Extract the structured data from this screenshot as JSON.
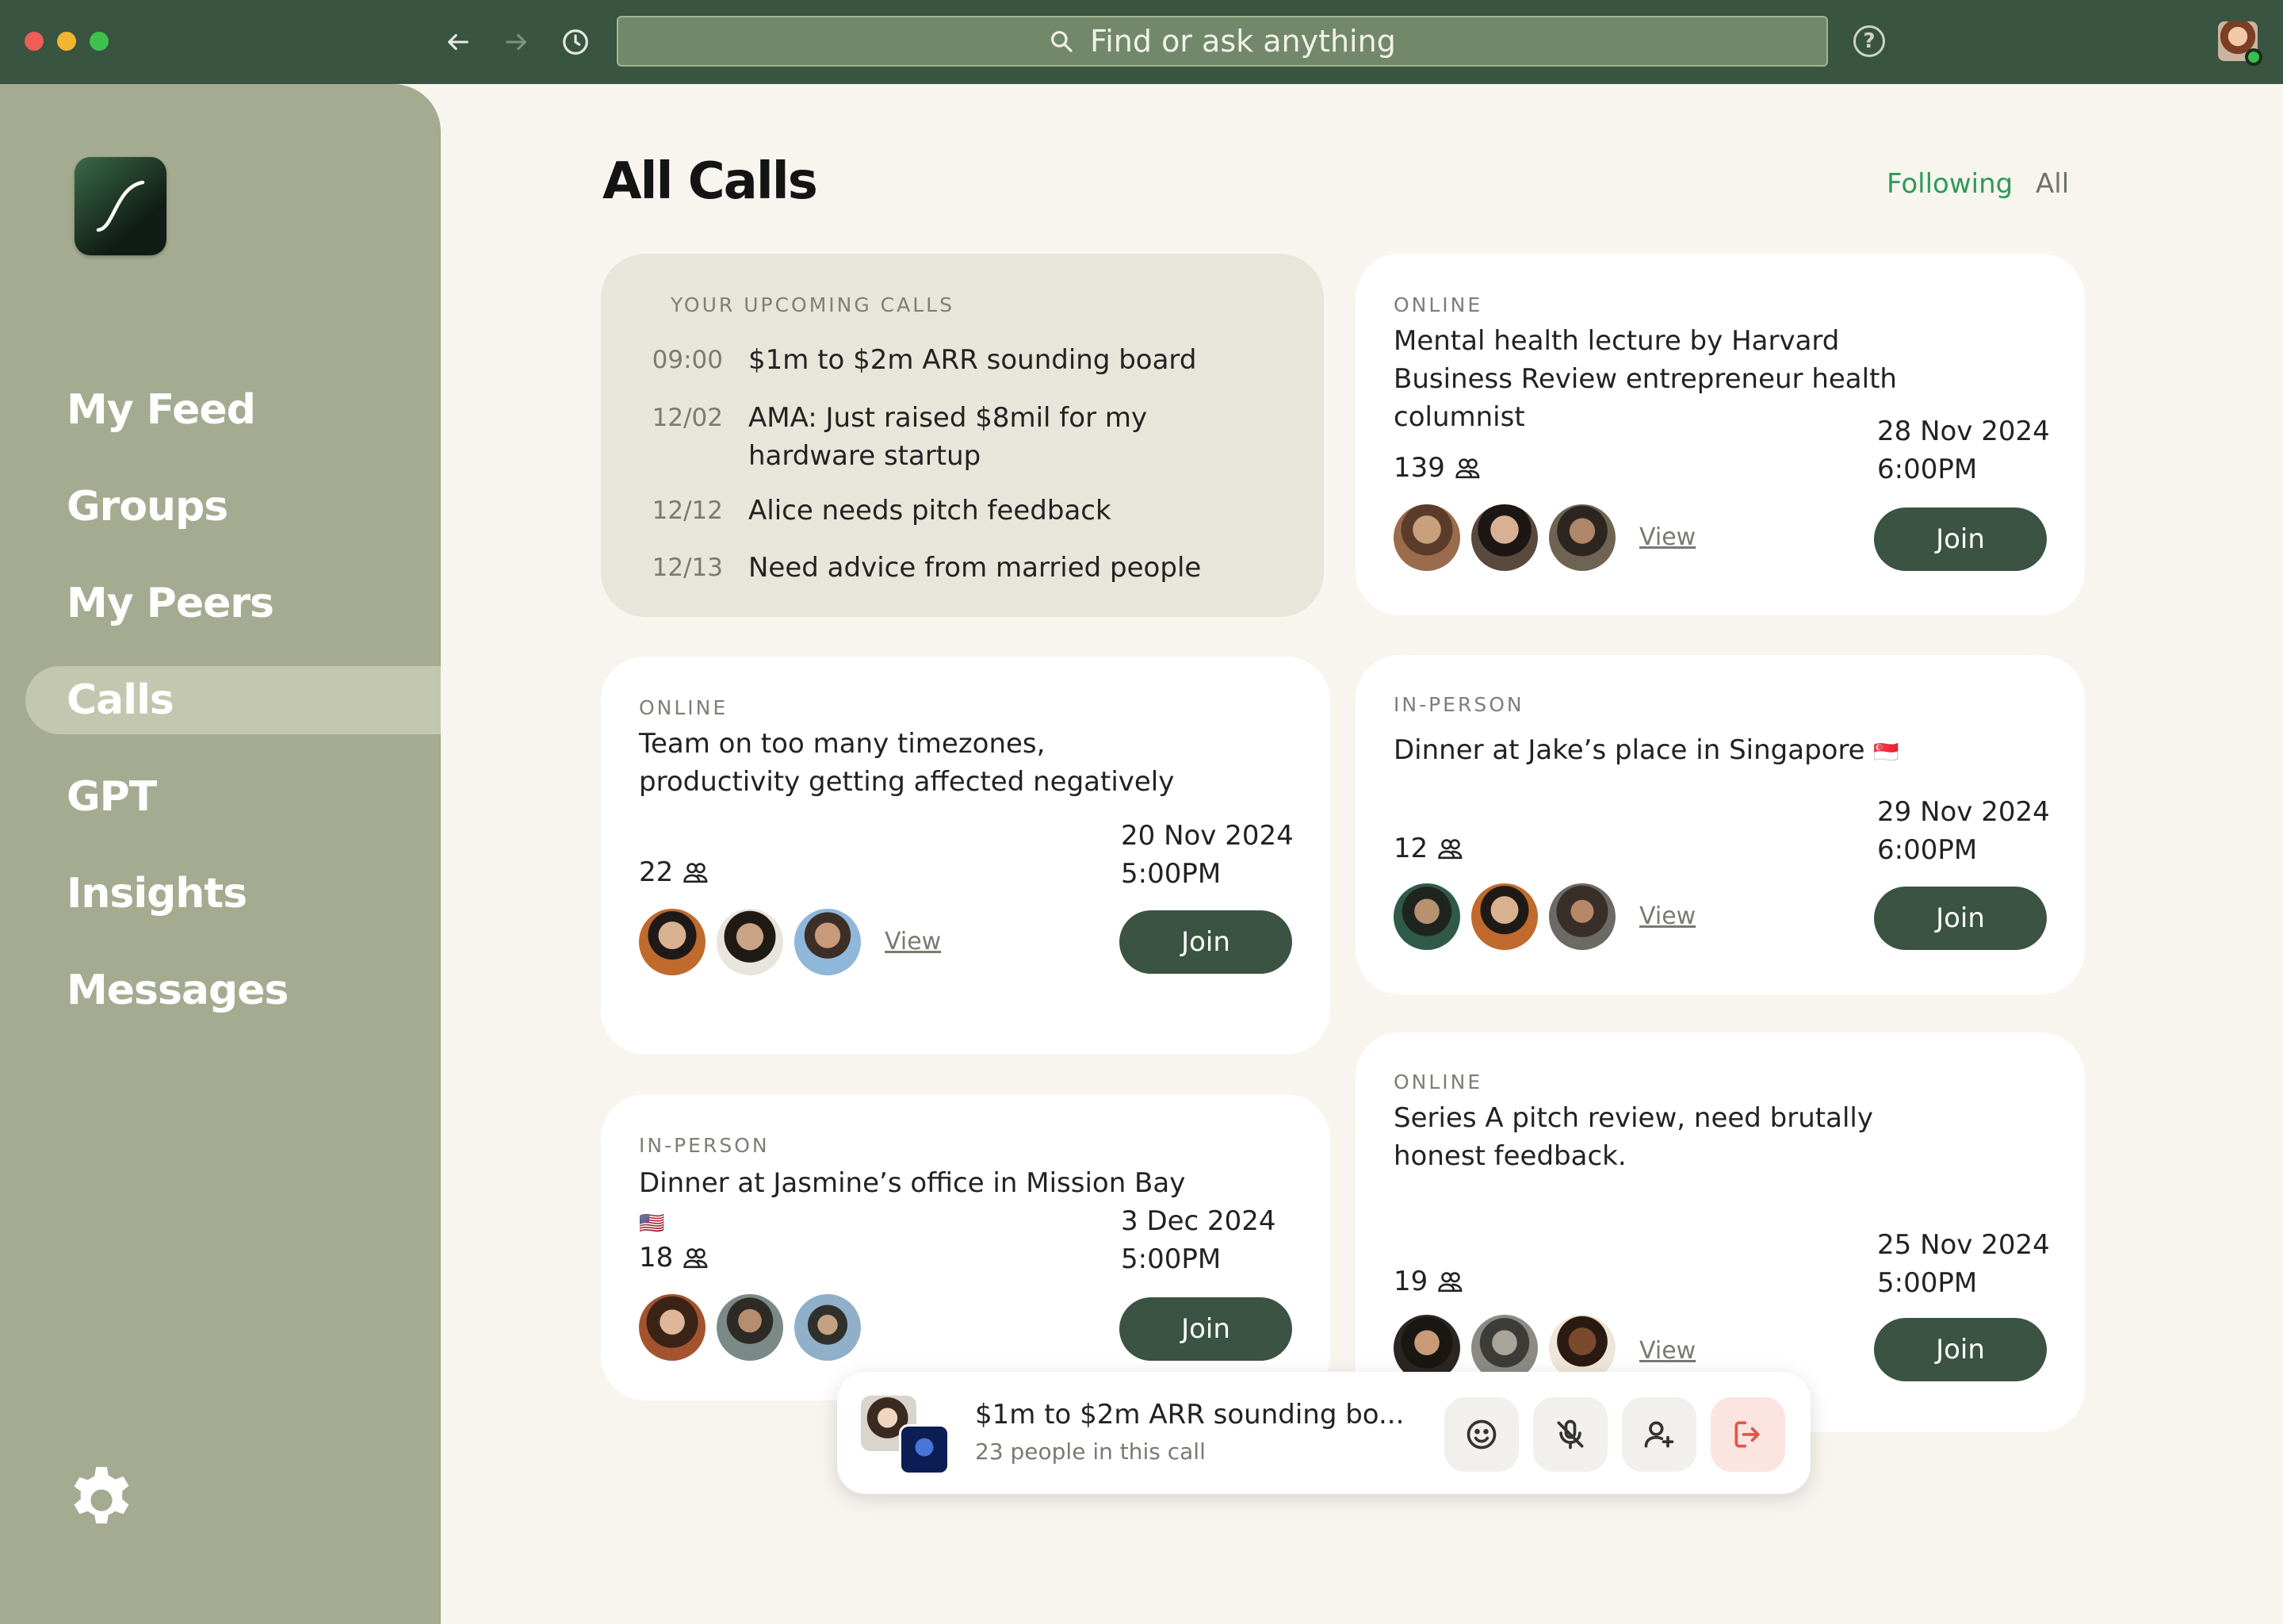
{
  "search": {
    "placeholder": "Find or ask anything"
  },
  "help_glyph": "?",
  "sidebar": {
    "items": [
      {
        "label": "My Feed",
        "active": false
      },
      {
        "label": "Groups",
        "active": false
      },
      {
        "label": "My Peers",
        "active": false
      },
      {
        "label": "Calls",
        "active": true
      },
      {
        "label": "GPT",
        "active": false
      },
      {
        "label": "Insights",
        "active": false
      },
      {
        "label": "Messages",
        "active": false
      }
    ]
  },
  "main": {
    "title": "All Calls",
    "filters": {
      "following": "Following",
      "all": "All",
      "selected": "Following"
    },
    "upcoming": {
      "heading": "YOUR UPCOMING CALLS",
      "items": [
        {
          "time": "09:00",
          "title": "$1m to $2m ARR sounding board"
        },
        {
          "time": "12/02",
          "title": "AMA: Just raised $8mil for my hardware startup"
        },
        {
          "time": "12/12",
          "title": "Alice needs pitch feedback"
        },
        {
          "time": "12/13",
          "title": "Need advice from married people"
        }
      ]
    },
    "calls": [
      {
        "type": "ONLINE",
        "title": "Mental health lecture by Harvard Business Review entrepreneur health columnist",
        "count": "139",
        "date": "28 Nov 2024",
        "time": "6:00PM",
        "view": "View",
        "join": "Join"
      },
      {
        "type": "ONLINE",
        "title": "Team on too many timezones, productivity getting affected negatively",
        "count": "22",
        "date": "20 Nov 2024",
        "time": "5:00PM",
        "view": "View",
        "join": "Join"
      },
      {
        "type": "IN-PERSON",
        "title": "Dinner at Jake’s place in Singapore",
        "flag": "🇸🇬",
        "count": "12",
        "date": "29 Nov 2024",
        "time": "6:00PM",
        "view": "View",
        "join": "Join"
      },
      {
        "type": "IN-PERSON",
        "title": "Dinner at Jasmine’s office in Mission Bay",
        "flag": "🇺🇸",
        "count": "18",
        "date": "3 Dec 2024",
        "time": "5:00PM",
        "join": "Join"
      },
      {
        "type": "ONLINE",
        "title": "Series A pitch review, need brutally honest feedback.",
        "count": "19",
        "date": "25 Nov 2024",
        "time": "5:00PM",
        "view": "View",
        "join": "Join"
      }
    ]
  },
  "active_call": {
    "title": "$1m to $2m ARR sounding bo...",
    "subtitle": "23 people in this call",
    "controls": [
      "smile-icon",
      "mic-off-icon",
      "add-person-icon",
      "leave-icon"
    ]
  },
  "colors": {
    "titlebar": "#395440",
    "sidebar": "#a4ab90",
    "accent_green": "#2e9a58",
    "join_button": "#3a5342",
    "background": "#f7f5ee",
    "leave_button": "#fce4e0"
  }
}
